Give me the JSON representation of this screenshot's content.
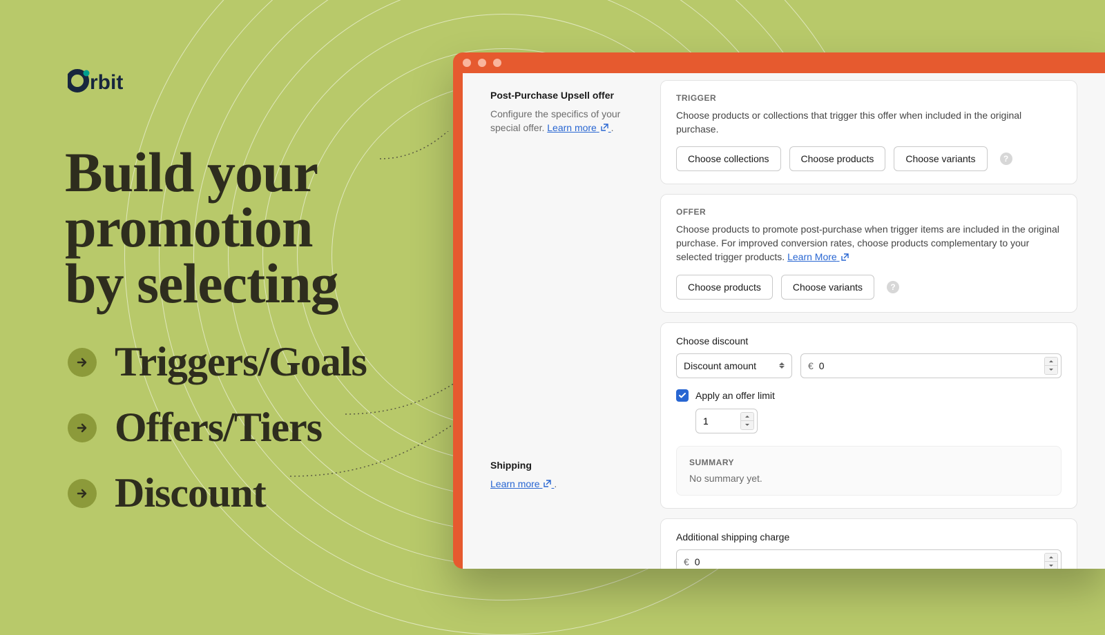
{
  "brand": {
    "name": "Orbit"
  },
  "headline": {
    "line1": "Build your",
    "line2": "promotion",
    "line3": "by selecting"
  },
  "bullets": [
    {
      "label": "Triggers/Goals"
    },
    {
      "label": "Offers/Tiers"
    },
    {
      "label": "Discount"
    }
  ],
  "left": {
    "upsell_title": "Post-Purchase Upsell offer",
    "upsell_desc_prefix": "Configure the specifics of your special offer. ",
    "learn_more": "Learn more",
    "shipping_title": "Shipping",
    "shipping_link": "Learn more"
  },
  "trigger": {
    "label": "TRIGGER",
    "desc": "Choose products or collections that trigger this offer when included in the original purchase.",
    "buttons": [
      "Choose collections",
      "Choose products",
      "Choose variants"
    ]
  },
  "offer": {
    "label": "OFFER",
    "desc_prefix": "Choose products to promote post-purchase when trigger items are included in the original purchase. For improved conversion rates, choose products complementary to your selected trigger products. ",
    "learn_more": "Learn More",
    "buttons": [
      "Choose products",
      "Choose variants"
    ]
  },
  "discount": {
    "field_label": "Choose discount",
    "select_value": "Discount amount",
    "currency": "€",
    "amount": "0",
    "apply_limit_label": "Apply an offer limit",
    "limit_value": "1",
    "summary_label": "SUMMARY",
    "summary_text": "No summary yet."
  },
  "shipping": {
    "label": "Additional shipping charge",
    "currency": "€",
    "amount": "0"
  }
}
